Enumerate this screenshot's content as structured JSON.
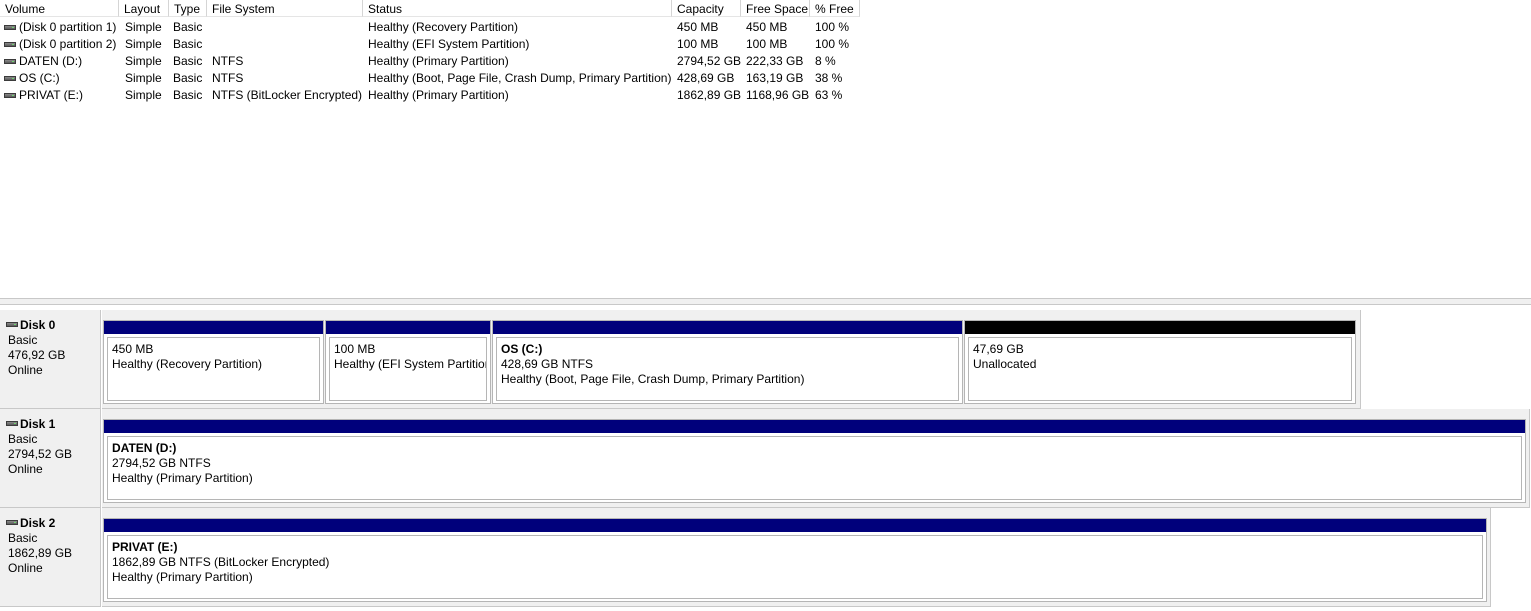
{
  "columns": [
    "Volume",
    "Layout",
    "Type",
    "File System",
    "Status",
    "Capacity",
    "Free Space",
    "% Free"
  ],
  "volumes": [
    {
      "volume": "(Disk 0 partition 1)",
      "layout": "Simple",
      "type": "Basic",
      "fs": "",
      "status": "Healthy (Recovery Partition)",
      "capacity": "450 MB",
      "free": "450 MB",
      "pct": "100 %"
    },
    {
      "volume": "(Disk 0 partition 2)",
      "layout": "Simple",
      "type": "Basic",
      "fs": "",
      "status": "Healthy (EFI System Partition)",
      "capacity": "100 MB",
      "free": "100 MB",
      "pct": "100 %"
    },
    {
      "volume": "DATEN (D:)",
      "layout": "Simple",
      "type": "Basic",
      "fs": "NTFS",
      "status": "Healthy (Primary Partition)",
      "capacity": "2794,52 GB",
      "free": "222,33 GB",
      "pct": "8 %"
    },
    {
      "volume": "OS (C:)",
      "layout": "Simple",
      "type": "Basic",
      "fs": "NTFS",
      "status": "Healthy (Boot, Page File, Crash Dump, Primary Partition)",
      "capacity": "428,69 GB",
      "free": "163,19 GB",
      "pct": "38 %"
    },
    {
      "volume": "PRIVAT (E:)",
      "layout": "Simple",
      "type": "Basic",
      "fs": "NTFS (BitLocker Encrypted)",
      "status": "Healthy (Primary Partition)",
      "capacity": "1862,89 GB",
      "free": "1168,96 GB",
      "pct": "63 %"
    }
  ],
  "disks": [
    {
      "name": "Disk 0",
      "type": "Basic",
      "size": "476,92 GB",
      "status": "Online",
      "partitions": [
        {
          "name": "",
          "detail": "450 MB",
          "status": "Healthy (Recovery Partition)",
          "bar_color": "#00007b"
        },
        {
          "name": "",
          "detail": "100 MB",
          "status": "Healthy (EFI System Partition",
          "bar_color": "#00007b"
        },
        {
          "name": "OS  (C:)",
          "detail": "428,69 GB NTFS",
          "status": "Healthy (Boot, Page File, Crash Dump, Primary Partition)",
          "bar_color": "#00007b"
        },
        {
          "name": "",
          "detail": "47,69 GB",
          "status": "Unallocated",
          "bar_color": "#000000"
        }
      ]
    },
    {
      "name": "Disk 1",
      "type": "Basic",
      "size": "2794,52 GB",
      "status": "Online",
      "partitions": [
        {
          "name": "DATEN  (D:)",
          "detail": "2794,52 GB NTFS",
          "status": "Healthy (Primary Partition)",
          "bar_color": "#00007b"
        }
      ]
    },
    {
      "name": "Disk 2",
      "type": "Basic",
      "size": "1862,89 GB",
      "status": "Online",
      "partitions": [
        {
          "name": "PRIVAT  (E:)",
          "detail": "1862,89 GB NTFS (BitLocker Encrypted)",
          "status": "Healthy (Primary Partition)",
          "bar_color": "#00007b"
        }
      ]
    }
  ]
}
